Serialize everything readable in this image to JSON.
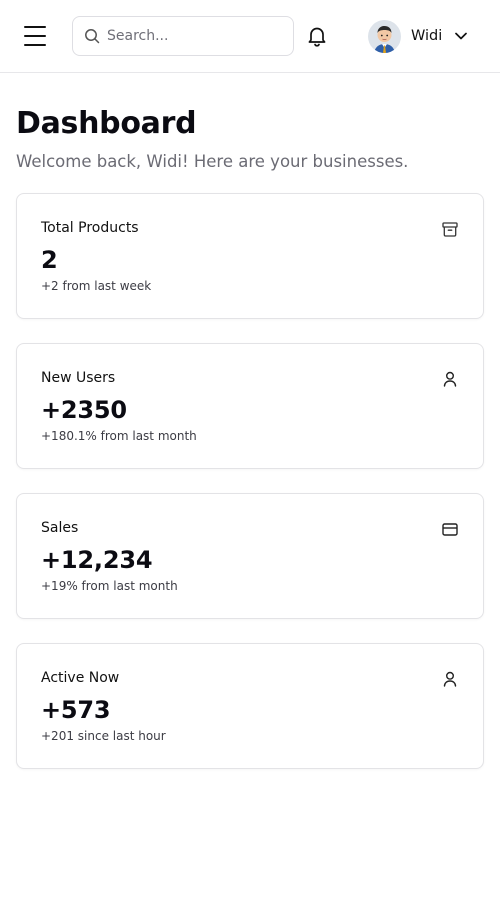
{
  "header": {
    "search_placeholder": "Search...",
    "user_name": "Widi"
  },
  "page": {
    "title": "Dashboard",
    "subtitle": "Welcome back, Widi! Here are your businesses."
  },
  "cards": [
    {
      "label": "Total Products",
      "value": "2",
      "note": "+2 from last week",
      "icon": "archive-icon"
    },
    {
      "label": "New Users",
      "value": "+2350",
      "note": "+180.1% from last month",
      "icon": "user-icon"
    },
    {
      "label": "Sales",
      "value": "+12,234",
      "note": "+19% from last month",
      "icon": "credit-card-icon"
    },
    {
      "label": "Active Now",
      "value": "+573",
      "note": "+201 since last hour",
      "icon": "user-icon"
    }
  ]
}
